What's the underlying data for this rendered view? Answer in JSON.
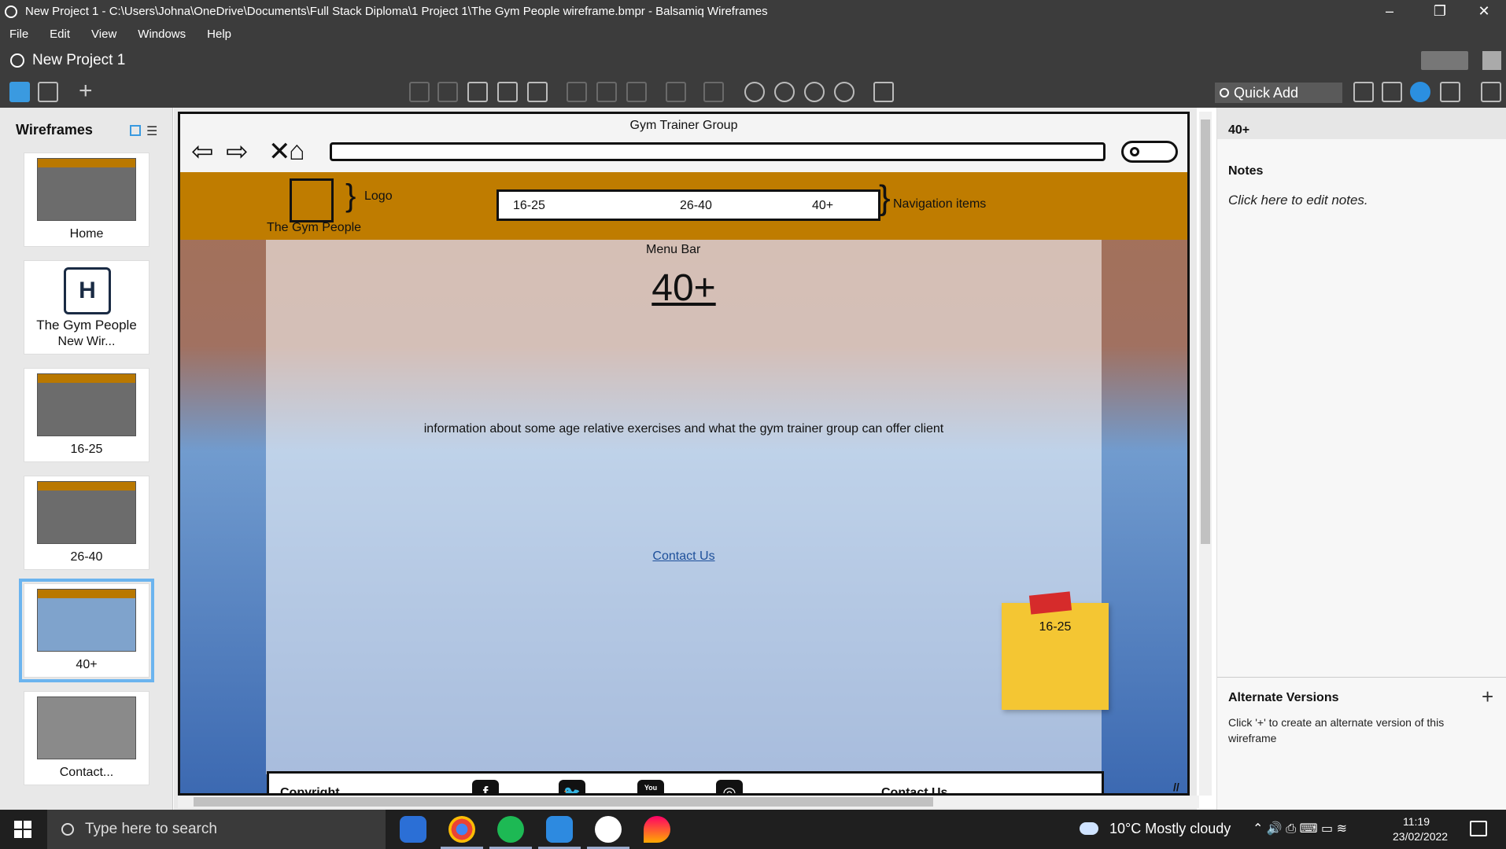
{
  "window": {
    "title": "New Project 1 - C:\\Users\\Johna\\OneDrive\\Documents\\Full Stack Diploma\\1 Project 1\\The Gym People wireframe.bmpr - Balsamiq Wireframes",
    "minimize": "–",
    "maximize": "❐",
    "close": "✕"
  },
  "menu": [
    "File",
    "Edit",
    "View",
    "Windows",
    "Help"
  ],
  "project": {
    "name": "New Project 1"
  },
  "toolbar": {
    "quick_add": "Quick Add"
  },
  "left_panel": {
    "title": "Wireframes",
    "thumbnails": [
      {
        "label": "Home",
        "selected": false
      },
      {
        "label": "New Wir...",
        "caption": "The Gym People",
        "selected": false
      },
      {
        "label": "16-25",
        "selected": false
      },
      {
        "label": "26-40",
        "selected": false
      },
      {
        "label": "40+",
        "selected": true
      },
      {
        "label": "Contact...",
        "selected": false
      }
    ]
  },
  "wireframe": {
    "browser_title": "Gym Trainer Group",
    "logo_text": "The Gym People",
    "logo_annotation": "Logo",
    "nav_items": [
      "16-25",
      "26-40",
      "40+"
    ],
    "nav_annotation": "Navigation items",
    "menu_annotation": "Menu Bar",
    "heading": "40+",
    "info_text": "information about some age relative exercises and what the gym trainer group can offer client",
    "contact_link": "Contact Us",
    "sticky_note": "16-25",
    "footer": {
      "left": "Copyright",
      "right": "Contact Us"
    },
    "social": [
      {
        "name": "facebook-icon",
        "glyph": "f"
      },
      {
        "name": "twitter-icon",
        "glyph": "🐦"
      },
      {
        "name": "youtube-icon",
        "glyph": "You Tube"
      },
      {
        "name": "instagram-icon",
        "glyph": "◎"
      }
    ]
  },
  "right_panel": {
    "title": "40+",
    "notes_heading": "Notes",
    "notes_placeholder": "Click here to edit notes.",
    "alt_heading": "Alternate Versions",
    "alt_plus": "+",
    "alt_desc": "Click '+' to create an alternate version of this wireframe"
  },
  "taskbar": {
    "search_placeholder": "Type here to search",
    "weather": "10°C  Mostly cloudy",
    "time": "11:19",
    "date": "23/02/2022"
  },
  "colors": {
    "brand": "#bf7c00",
    "selection": "#6bb4ef",
    "chrome": "#3c3c3c"
  }
}
